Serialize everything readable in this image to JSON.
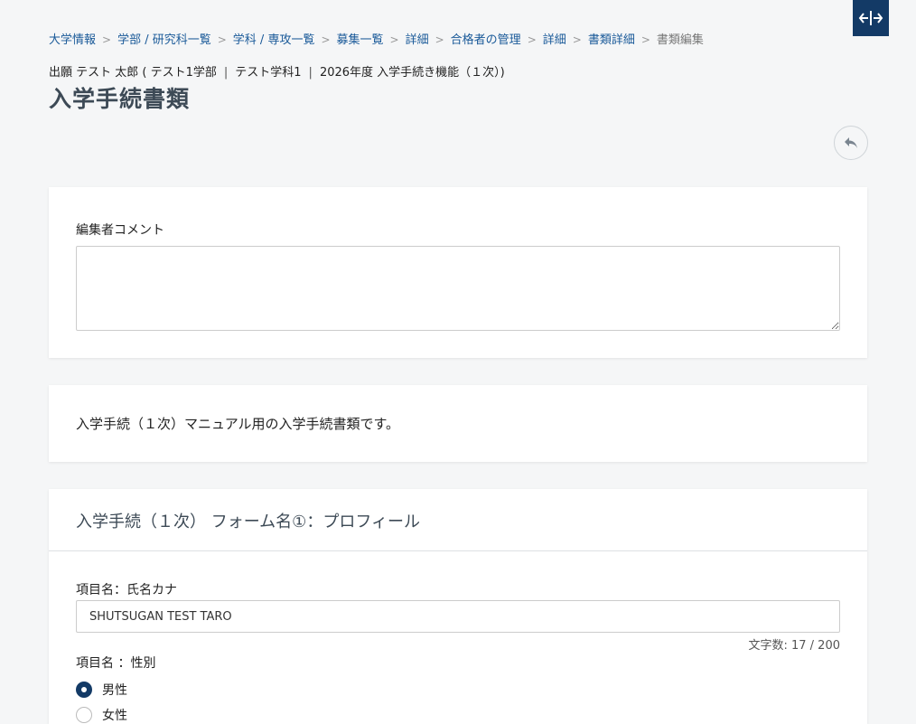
{
  "breadcrumb": [
    "大学情報",
    "学部 / 研究科一覧",
    "学科 / 専攻一覧",
    "募集一覧",
    "詳細",
    "合格者の管理",
    "詳細",
    "書類詳細"
  ],
  "breadcrumb_current": "書類編集",
  "breadcrumb_separator": ">",
  "subtitle": {
    "applicant": "出願 テスト 太郎 ( テスト1学部",
    "department": "テスト学科1",
    "program": "2026年度 入学手続き機能（１次）)"
  },
  "page_title": "入学手続書類",
  "editor_comment": {
    "label": "編集者コメント",
    "value": ""
  },
  "description": "入学手続（１次）マニュアル用の入学手続書類です。",
  "form": {
    "title": "入学手続（１次） フォーム名①：プロフィール",
    "kana": {
      "label": "項目名：氏名カナ",
      "value": "SHUTSUGAN TEST TARO",
      "counter": "文字数: 17 / 200"
    },
    "gender": {
      "label": "項目名 ：性別",
      "options": [
        "男性",
        "女性"
      ],
      "selected": "男性"
    }
  },
  "colors": {
    "accent": "#133a66",
    "link": "#1a5a99",
    "title": "#3d4a56"
  },
  "icons": {
    "expand": "expand-horizontal-icon",
    "back": "reply-arrow-icon"
  }
}
